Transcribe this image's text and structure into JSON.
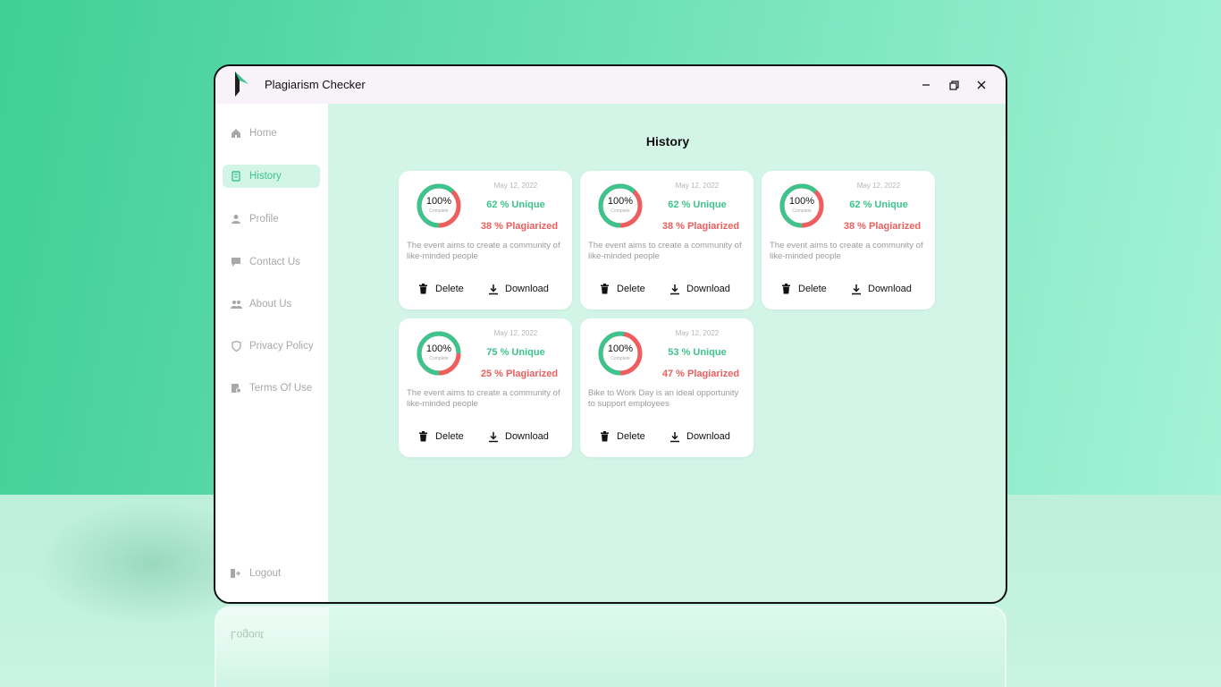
{
  "window": {
    "title": "Plagiarism Checker",
    "controls": {
      "minimize": "–",
      "maximize": "❐",
      "close": "✕"
    }
  },
  "sidebar": {
    "items": [
      {
        "label": "Home",
        "icon": "home-icon",
        "active": false
      },
      {
        "label": "History",
        "icon": "history-icon",
        "active": true
      },
      {
        "label": "Profile",
        "icon": "user-icon",
        "active": false
      },
      {
        "label": "Contact Us",
        "icon": "chat-icon",
        "active": false
      },
      {
        "label": "About Us",
        "icon": "users-icon",
        "active": false
      },
      {
        "label": "Privacy Policy",
        "icon": "shield-icon",
        "active": false
      },
      {
        "label": "Terms Of Use",
        "icon": "document-icon",
        "active": false
      }
    ],
    "logout_label": "Logout"
  },
  "main": {
    "title": "History",
    "cards": [
      {
        "progress": "100%",
        "progress_sub": "Complete",
        "date": "May 12, 2022",
        "unique": "62 % Unique",
        "plagiarized": "38 % Plagiarized",
        "unique_fraction": 0.62,
        "description": "The event aims to create a community of like-minded people",
        "delete_label": "Delete",
        "download_label": "Download"
      },
      {
        "progress": "100%",
        "progress_sub": "Complete",
        "date": "May 12, 2022",
        "unique": "62 % Unique",
        "plagiarized": "38 % Plagiarized",
        "unique_fraction": 0.62,
        "description": "The event aims to create a community of like-minded people",
        "delete_label": "Delete",
        "download_label": "Download"
      },
      {
        "progress": "100%",
        "progress_sub": "Complete",
        "date": "May 12, 2022",
        "unique": "62 % Unique",
        "plagiarized": "38 % Plagiarized",
        "unique_fraction": 0.62,
        "description": "The event aims to create a community of like-minded people",
        "delete_label": "Delete",
        "download_label": "Download"
      },
      {
        "progress": "100%",
        "progress_sub": "Complete",
        "date": "May 12, 2022",
        "unique": "75 % Unique",
        "plagiarized": "25 % Plagiarized",
        "unique_fraction": 0.75,
        "description": "The event aims to create a community of like-minded people",
        "delete_label": "Delete",
        "download_label": "Download"
      },
      {
        "progress": "100%",
        "progress_sub": "Complete",
        "date": "May 12, 2022",
        "unique": "53 % Unique",
        "plagiarized": "47 % Plagiarized",
        "unique_fraction": 0.53,
        "description": "Bike to Work Day is an ideal opportunity to support employees",
        "delete_label": "Delete",
        "download_label": "Download"
      }
    ]
  },
  "colors": {
    "accent": "#3cc48c",
    "danger": "#ef5e5e",
    "content_bg": "#d3f5e8"
  }
}
